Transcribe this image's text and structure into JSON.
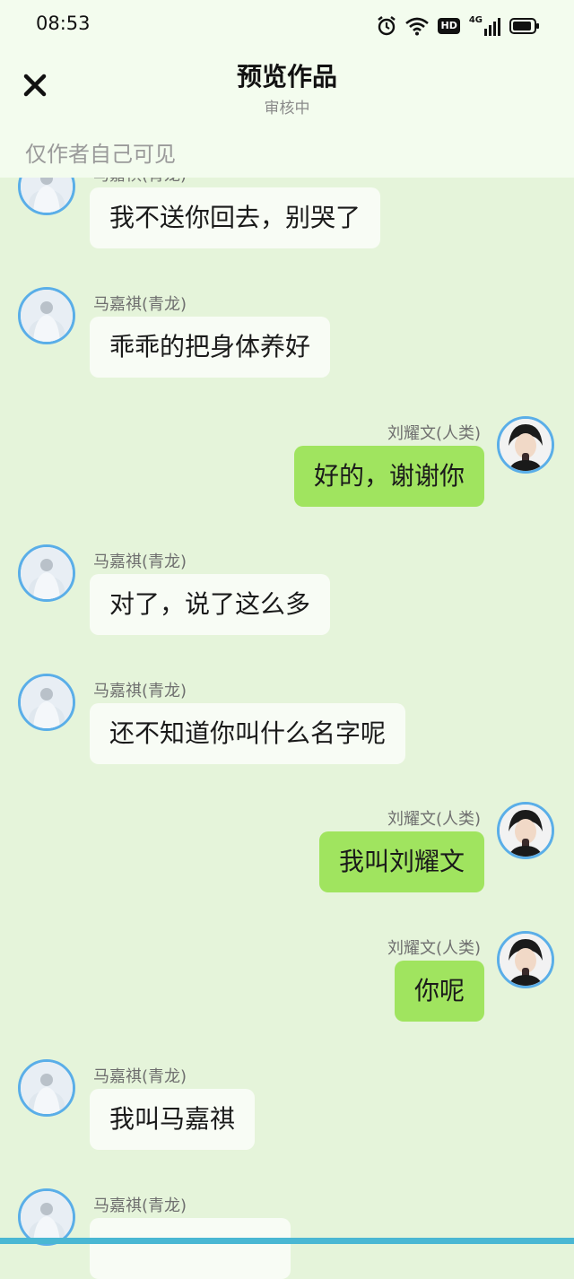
{
  "status_bar": {
    "time": "08:53",
    "icons": [
      "alarm-icon",
      "wifi-icon",
      "hd-icon",
      "4g-signal-icon",
      "battery-icon"
    ],
    "hd_label": "HD",
    "network_label": "4G"
  },
  "header": {
    "close_icon": "close-icon",
    "title": "预览作品",
    "subtitle": "审核中",
    "visibility_note": "仅作者自己可见"
  },
  "colors": {
    "background": "#e5f4da",
    "header_background": "#f3fcee",
    "left_bubble": "#f8fcf5",
    "right_bubble": "#a0e45f",
    "avatar_border": "#5aaee8",
    "bottom_strip": "#4ab7d3"
  },
  "messages": [
    {
      "side": "left",
      "sender": "马嘉祺(青龙)",
      "text": "我不送你回去，别哭了"
    },
    {
      "side": "left",
      "sender": "马嘉祺(青龙)",
      "text": "乖乖的把身体养好"
    },
    {
      "side": "right",
      "sender": "刘耀文(人类)",
      "text": "好的，谢谢你"
    },
    {
      "side": "left",
      "sender": "马嘉祺(青龙)",
      "text": "对了，说了这么多"
    },
    {
      "side": "left",
      "sender": "马嘉祺(青龙)",
      "text": "还不知道你叫什么名字呢"
    },
    {
      "side": "right",
      "sender": "刘耀文(人类)",
      "text": "我叫刘耀文"
    },
    {
      "side": "right",
      "sender": "刘耀文(人类)",
      "text": "你呢"
    },
    {
      "side": "left",
      "sender": "马嘉祺(青龙)",
      "text": "我叫马嘉祺"
    },
    {
      "side": "left",
      "sender": "马嘉祺(青龙)",
      "text": ""
    }
  ]
}
